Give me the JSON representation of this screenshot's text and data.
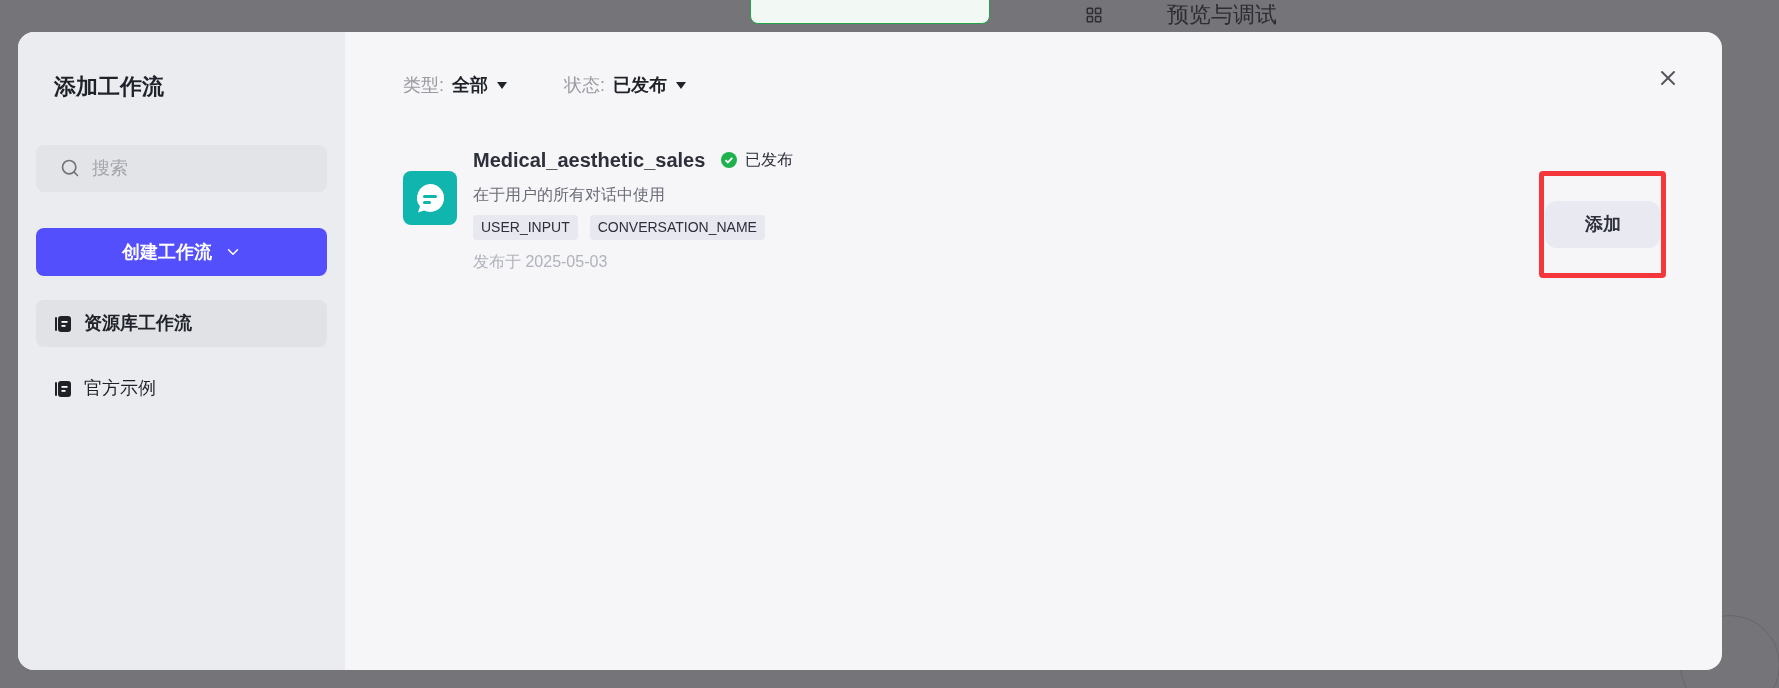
{
  "background": {
    "header_title": "预览与调试"
  },
  "dialog": {
    "title": "添加工作流",
    "search": {
      "placeholder": "搜索"
    },
    "create_button": "创建工作流",
    "nav": [
      {
        "label": "资源库工作流",
        "selected": true
      },
      {
        "label": "官方示例",
        "selected": false
      }
    ],
    "filters": [
      {
        "label": "类型:",
        "value": "全部"
      },
      {
        "label": "状态:",
        "value": "已发布"
      }
    ],
    "workflows": [
      {
        "name": "Medical_aesthetic_sales",
        "status": "已发布",
        "published": true,
        "description": "在于用户的所有对话中使用",
        "tags": [
          "USER_INPUT",
          "CONVERSATION_NAME"
        ],
        "date": "发布于 2025-05-03",
        "action": "添加",
        "highlighted": true
      }
    ]
  }
}
